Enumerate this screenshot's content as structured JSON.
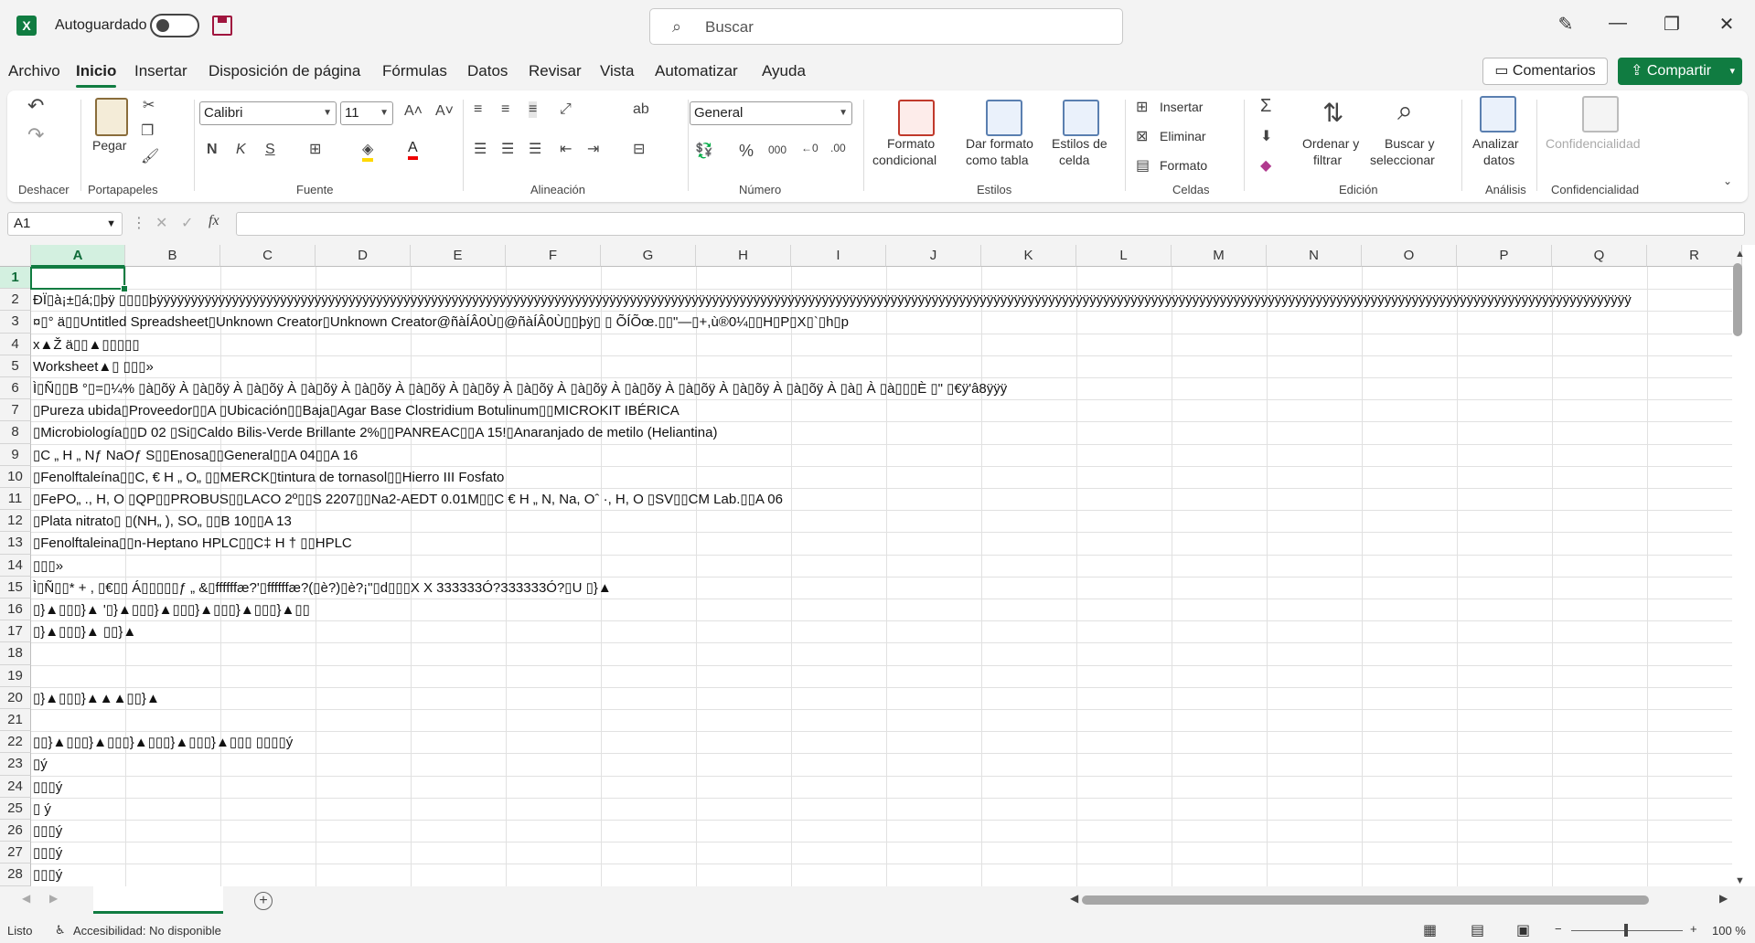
{
  "title": {
    "autosave_label": "Autoguardado",
    "search_placeholder": "Buscar"
  },
  "menu": [
    "Archivo",
    "Inicio",
    "Insertar",
    "Disposición de página",
    "Fórmulas",
    "Datos",
    "Revisar",
    "Vista",
    "Automatizar",
    "Ayuda"
  ],
  "actions": {
    "comments": "Comentarios",
    "share": "Compartir"
  },
  "ribbon": {
    "paste": "Pegar",
    "undo_group": "Deshacer",
    "clipboard_group": "Portapapeles",
    "font_name": "Calibri",
    "font_size": "11",
    "font_group": "Fuente",
    "align_group": "Alineación",
    "number_format": "General",
    "number_group": "Número",
    "cond_format_1": "Formato",
    "cond_format_2": "condicional",
    "table_format_1": "Dar formato",
    "table_format_2": "como tabla",
    "cell_styles_1": "Estilos de",
    "cell_styles_2": "celda",
    "styles_group": "Estilos",
    "insert": "Insertar",
    "delete": "Eliminar",
    "format": "Formato",
    "cells_group": "Celdas",
    "sort_1": "Ordenar y",
    "sort_2": "filtrar",
    "find_1": "Buscar y",
    "find_2": "seleccionar",
    "edit_group": "Edición",
    "analyze_1": "Analizar",
    "analyze_2": "datos",
    "analysis_group": "Análisis",
    "confidential": "Confidencialidad",
    "confidential_group": "Confidencialidad"
  },
  "formula_bar": {
    "name_box": "A1",
    "fx": "fx"
  },
  "columns": [
    "A",
    "B",
    "C",
    "D",
    "E",
    "F",
    "G",
    "H",
    "I",
    "J",
    "K",
    "L",
    "M",
    "N",
    "O",
    "P",
    "Q",
    "R"
  ],
  "rows": [
    "1",
    "2",
    "3",
    "4",
    "5",
    "6",
    "7",
    "8",
    "9",
    "10",
    "11",
    "12",
    "13",
    "14",
    "15",
    "16",
    "17",
    "18",
    "19",
    "20",
    "21",
    "22",
    "23",
    "24",
    "25",
    "26",
    "27",
    "28"
  ],
  "cells": {
    "r2": "ÐÏ▯à¡±▯á;▯þÿ      ▯▯▯▯þÿÿÿÿÿÿÿÿÿÿÿÿÿÿÿÿÿÿÿÿÿÿÿÿÿÿÿÿÿÿÿÿÿÿÿÿÿÿÿÿÿÿÿÿÿÿÿÿÿÿÿÿÿÿÿÿÿÿÿÿÿÿÿÿÿÿÿÿÿÿÿÿÿÿÿÿÿÿÿÿÿÿÿÿÿÿÿÿÿÿÿÿÿÿÿÿÿÿÿÿÿÿÿÿÿÿÿÿÿÿÿÿÿÿÿÿÿÿÿÿÿÿÿÿÿÿÿÿÿÿÿÿÿÿÿÿÿÿÿÿÿÿÿÿÿÿÿÿÿÿÿÿÿÿÿÿÿÿÿÿÿÿÿÿÿÿÿÿÿÿÿÿÿÿÿÿÿÿÿÿÿÿÿÿÿÿÿÿÿÿÿÿÿÿÿÿÿÿÿÿÿÿÿÿÿÿÿÿÿÿÿÿÿÿÿ",
    "r3": "¤▯°  ä▯▯Untitled Spreadsheet▯Unknown Creator▯Unknown Creator@ñàÍÂ0Ù▯@ñàÍÂ0Ù▯▯þÿ▯  ▯  ÕÍÕœ.▯▯\"—▯+,ù®0¼▯▯H▯P▯X▯`▯h▯p",
    "r4": "x▲Ž  ä▯▯▲▯▯▯▯▯",
    "r5": "Worksheet▲▯      ▯▯▯»",
    "r6": "Ì▯Ñ▯▯B  °▯=▯¼%  ▯à▯õÿ À        ▯à▯õÿ À        ▯à▯õÿ À        ▯à▯õÿ À        ▯à▯õÿ À        ▯à▯õÿ À        ▯à▯õÿ À        ▯à▯õÿ À        ▯à▯õÿ À        ▯à▯õÿ À        ▯à▯õÿ À        ▯à▯õÿ À        ▯à▯õÿ À        ▯à▯ À           ▯à▯▯▯È           ▯\"  ▯€ÿ'â8ÿÿÿ",
    "r7": "▯Pureza ubida▯Proveedor▯▯A ▯Ubicación▯▯Baja▯Agar Base Clostridium Botulinum▯▯MICROKIT IBÉRICA",
    "r8": "▯Microbiología▯▯D 02  ▯Si▯Caldo Bilis-Verde Brillante 2%▯▯PANREAC▯▯A 15!▯Anaranjado de metilo (Heliantina)",
    "r9": "▯C „ H „ Nƒ NaOƒ S▯▯Enosa▯▯General▯▯A 04▯▯A 16",
    "r10": "▯Fenolftaleína▯▯C, € H „ O„ ▯▯MERCK▯tintura de tornasol▯▯Hierro III Fosfato",
    "r11": "▯FePO„ ., H, O  ▯QP▯▯PROBUS▯▯LACO 2º▯▯S 2207▯▯Na2-AEDT  0.01M▯▯C € H „ N, Na, Oˆ ·, H, O  ▯SV▯▯CM Lab.▯▯A 06",
    "r12": "▯Plata nitrato▯ ▯(NH„ ), SO„ ▯▯B 10▯▯A 13",
    "r13": "▯Fenolftaleina▯▯n-Heptano HPLC▯▯C‡ H † ▯▯HPLC",
    "r14": "               ▯▯▯»",
    "r15": "Ì▯Ñ▯▯* + , ▯€▯▯  Á▯▯▯▯▯ƒ  „  &▯ffffffæ?'▯ffffffæ?(▯è?)▯è?¡\"▯d▯▯▯X  X  333333Ó?333333Ó?▯U  ▯}▲",
    "r16": "▯}▲▯▯▯}▲    '▯}▲▯▯▯}▲▯▯▯}▲▯▯▯}▲▯▯▯}▲▯▯",
    "r17": "▯}▲▯▯▯}▲                          ▯▯}▲",
    "r20": "▯}▲▯▯▯}▲▲▲▯▯}▲",
    "r22": "▯▯}▲▯▯▯}▲▯▯▯}▲▯▯▯}▲▯▯▯}▲▯▯▯   ▯▯▯▯ý",
    "r23": "▯ý",
    "r24": "▯▯▯ý",
    "r25": "  ▯  ý",
    "r26": "▯▯▯ý",
    "r27": "▯▯▯ý",
    "r28": "▯▯▯ý"
  },
  "status": {
    "ready": "Listo",
    "accessibility": "Accesibilidad: No disponible",
    "zoom": "100 %"
  }
}
